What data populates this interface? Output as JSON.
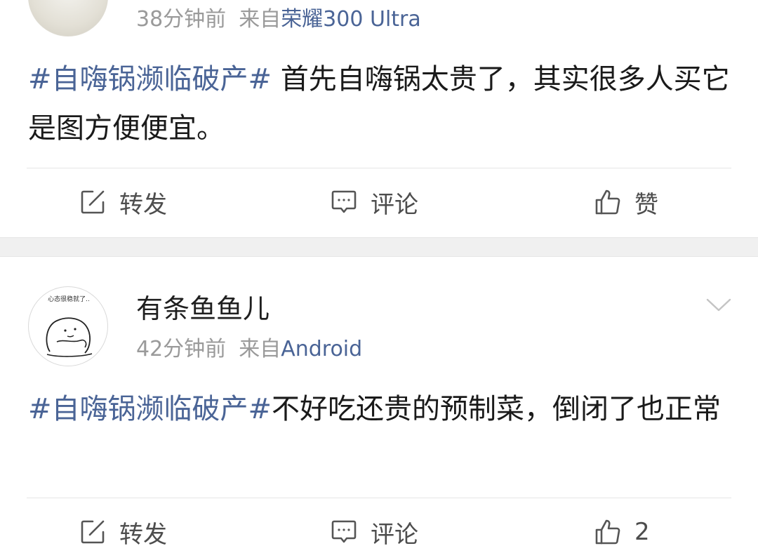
{
  "posts": [
    {
      "username": "",
      "time": "38分钟前",
      "source_prefix": "来自",
      "device": "荣耀300 Ultra",
      "topic": "#自嗨锅濒临破产#",
      "body": " 首先自嗨锅太贵了，其实很多人买它是图方便便宜。",
      "actions": {
        "repost": "转发",
        "comment": "评论",
        "like": "赞"
      }
    },
    {
      "username": "有条鱼鱼儿",
      "avatar_caption": "心态很稳就了..",
      "time": "42分钟前",
      "source_prefix": "来自",
      "device": "Android",
      "topic": "#自嗨锅濒临破产#",
      "body": "不好吃还贵的预制菜，倒闭了也正常",
      "actions": {
        "repost": "转发",
        "comment": "评论",
        "like": "2"
      }
    }
  ],
  "colors": {
    "link": "#4a6496",
    "meta": "#9a9a9a",
    "separator": "#f0f0f0"
  },
  "icons": {
    "repost": "edit-square-icon",
    "comment": "comment-bubble-icon",
    "like": "thumbs-up-icon",
    "expand": "chevron-down-icon"
  }
}
